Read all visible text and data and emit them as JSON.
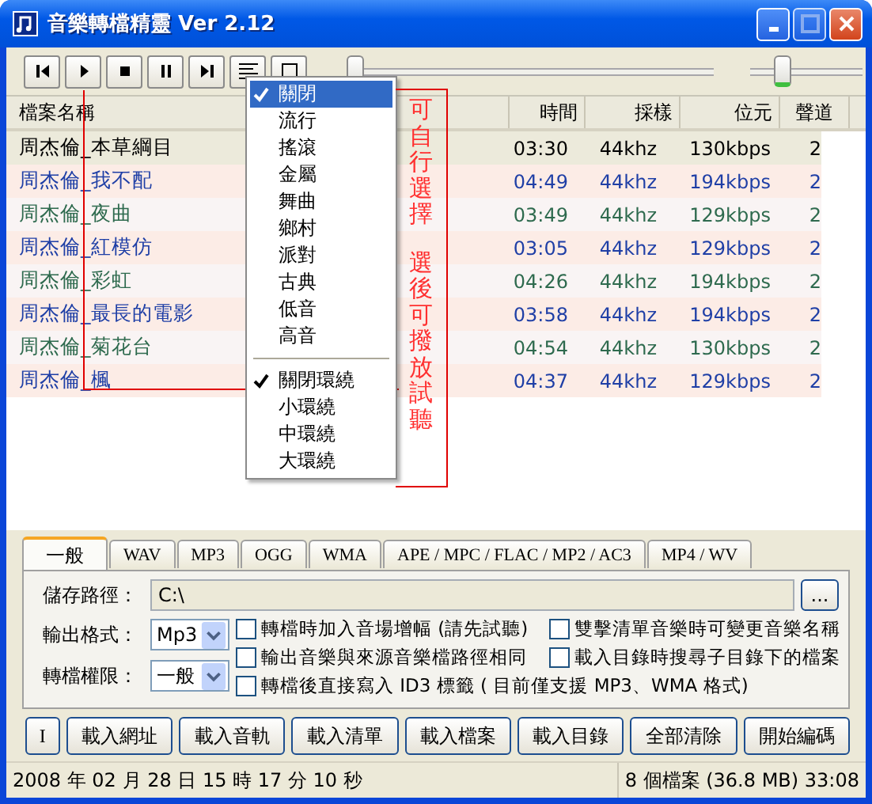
{
  "window": {
    "title": "音樂轉檔精靈 Ver 2.12"
  },
  "position_slider": {
    "level": 0
  },
  "volume_slider": {
    "level": 0.25
  },
  "file_list": {
    "columns": [
      "檔案名稱",
      "時間",
      "採樣",
      "位元",
      "聲道"
    ],
    "rows": [
      {
        "name": "周杰倫_本草綱目",
        "time": "03:30",
        "sampling": "44khz",
        "bitrate": "130kbps",
        "channels": "2",
        "selected": true,
        "color": "#000000"
      },
      {
        "name": "周杰倫_我不配",
        "time": "04:49",
        "sampling": "44khz",
        "bitrate": "194kbps",
        "channels": "2",
        "selected": false,
        "color": "#1f3fa6"
      },
      {
        "name": "周杰倫_夜曲",
        "time": "03:49",
        "sampling": "44khz",
        "bitrate": "129kbps",
        "channels": "2",
        "selected": false,
        "color": "#2e6a4e"
      },
      {
        "name": "周杰倫_紅模仿",
        "time": "03:05",
        "sampling": "44khz",
        "bitrate": "129kbps",
        "channels": "2",
        "selected": false,
        "color": "#1f3fa6"
      },
      {
        "name": "周杰倫_彩虹",
        "time": "04:26",
        "sampling": "44khz",
        "bitrate": "194kbps",
        "channels": "2",
        "selected": false,
        "color": "#2e6a4e"
      },
      {
        "name": "周杰倫_最長的電影",
        "time": "03:58",
        "sampling": "44khz",
        "bitrate": "194kbps",
        "channels": "2",
        "selected": false,
        "color": "#1f3fa6"
      },
      {
        "name": "周杰倫_菊花台",
        "time": "04:54",
        "sampling": "44khz",
        "bitrate": "130kbps",
        "channels": "2",
        "selected": false,
        "color": "#2e6a4e"
      },
      {
        "name": "周杰倫_楓",
        "time": "04:37",
        "sampling": "44khz",
        "bitrate": "129kbps",
        "channels": "2",
        "selected": false,
        "color": "#1f3fa6"
      }
    ]
  },
  "effects_menu": {
    "groups": [
      {
        "items": [
          {
            "label": "關閉",
            "checked": true,
            "selected": true
          },
          {
            "label": "流行",
            "checked": false,
            "selected": false
          },
          {
            "label": "搖滾",
            "checked": false,
            "selected": false
          },
          {
            "label": "金屬",
            "checked": false,
            "selected": false
          },
          {
            "label": "舞曲",
            "checked": false,
            "selected": false
          },
          {
            "label": "鄉村",
            "checked": false,
            "selected": false
          },
          {
            "label": "派對",
            "checked": false,
            "selected": false
          },
          {
            "label": "古典",
            "checked": false,
            "selected": false
          },
          {
            "label": "低音",
            "checked": false,
            "selected": false
          },
          {
            "label": "高音",
            "checked": false,
            "selected": false
          }
        ]
      },
      {
        "items": [
          {
            "label": "關閉環繞",
            "checked": true,
            "selected": false
          },
          {
            "label": "小環繞",
            "checked": false,
            "selected": false
          },
          {
            "label": "中環繞",
            "checked": false,
            "selected": false
          },
          {
            "label": "大環繞",
            "checked": false,
            "selected": false
          }
        ]
      }
    ]
  },
  "annotation": {
    "lines": [
      "可自行選擇",
      "選後可撥放試聽"
    ]
  },
  "settings": {
    "tabs": [
      {
        "label": "一般",
        "selected": true
      },
      {
        "label": "WAV",
        "selected": false
      },
      {
        "label": "MP3",
        "selected": false
      },
      {
        "label": "OGG",
        "selected": false
      },
      {
        "label": "WMA",
        "selected": false
      },
      {
        "label": "APE / MPC / FLAC / MP2 / AC3",
        "selected": false
      },
      {
        "label": "MP4 / WV",
        "selected": false
      }
    ],
    "save_path": {
      "label": "儲存路徑：",
      "value": "C:\\"
    },
    "browse_button": "...",
    "output_format": {
      "label": "輸出格式：",
      "value": "Mp3"
    },
    "permission": {
      "label": "轉檔權限：",
      "value": "一般"
    },
    "options": [
      {
        "label": "轉檔時加入音場增幅 (請先試聽)",
        "checked": false
      },
      {
        "label": "雙擊清單音樂時可變更音樂名稱",
        "checked": false
      },
      {
        "label": "輸出音樂與來源音樂檔路徑相同",
        "checked": false
      },
      {
        "label": "載入目錄時搜尋子目錄下的檔案",
        "checked": false
      },
      {
        "label": "轉檔後直接寫入 ID3 標籤 ( 目前僅支援 MP3、WMA 格式)",
        "checked": false
      }
    ]
  },
  "buttons": [
    "I",
    "載入網址",
    "載入音軌",
    "載入清單",
    "載入檔案",
    "載入目錄",
    "全部清除",
    "開始編碼"
  ],
  "status_bar": {
    "datetime": "2008 年 02 月 28 日 15 時 17 分 10 秒",
    "summary": "8 個檔案 (36.8 MB) 33:08"
  }
}
